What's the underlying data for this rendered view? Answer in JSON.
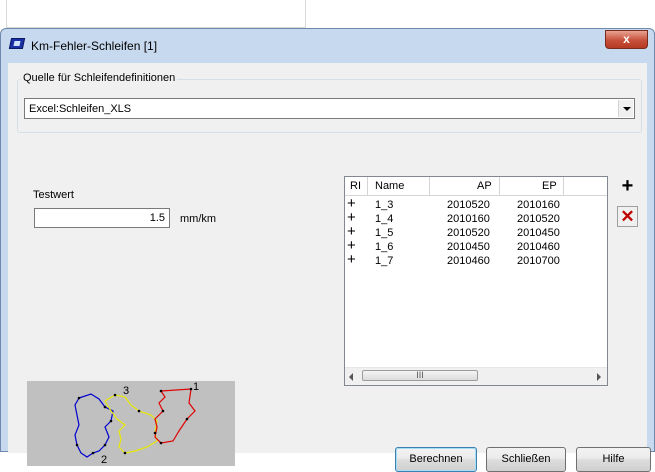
{
  "window": {
    "title": "Km-Fehler-Schleifen [1]",
    "close_glyph": "x"
  },
  "source_group": {
    "legend": "Quelle für Schleifendefinitionen",
    "combo_value": "Excel:Schleifen_XLS"
  },
  "testwert": {
    "label": "Testwert",
    "value": "1.5",
    "unit": "mm/km"
  },
  "list": {
    "headers": {
      "ri": "RI",
      "name": "Name",
      "ap": "AP",
      "ep": "EP"
    },
    "rows": [
      {
        "ri": "+",
        "name": "1_3",
        "ap": "2010520",
        "ep": "2010160"
      },
      {
        "ri": "+",
        "name": "1_4",
        "ap": "2010160",
        "ep": "2010520"
      },
      {
        "ri": "+",
        "name": "1_5",
        "ap": "2010520",
        "ep": "2010450"
      },
      {
        "ri": "+",
        "name": "1_6",
        "ap": "2010450",
        "ep": "2010460"
      },
      {
        "ri": "+",
        "name": "1_7",
        "ap": "2010460",
        "ep": "2010700"
      }
    ],
    "scroll_thumb_glyph": "III"
  },
  "toolbar": {
    "add_glyph": "+",
    "delete_glyph": "✕"
  },
  "preview": {
    "labels": {
      "loop1": "1",
      "loop2": "2",
      "loop3": "3"
    },
    "colors": {
      "loop1": "#e00000",
      "loop2": "#0000d0",
      "loop3": "#e8e800",
      "background": "#c0c0c0"
    }
  },
  "buttons": {
    "calculate": "Berechnen",
    "close": "Schließen",
    "help": "Hilfe"
  },
  "colors": {
    "title_bar": "#c7d9ee",
    "close_button": "#c7503a",
    "dialog_background": "#f0f0f0"
  }
}
